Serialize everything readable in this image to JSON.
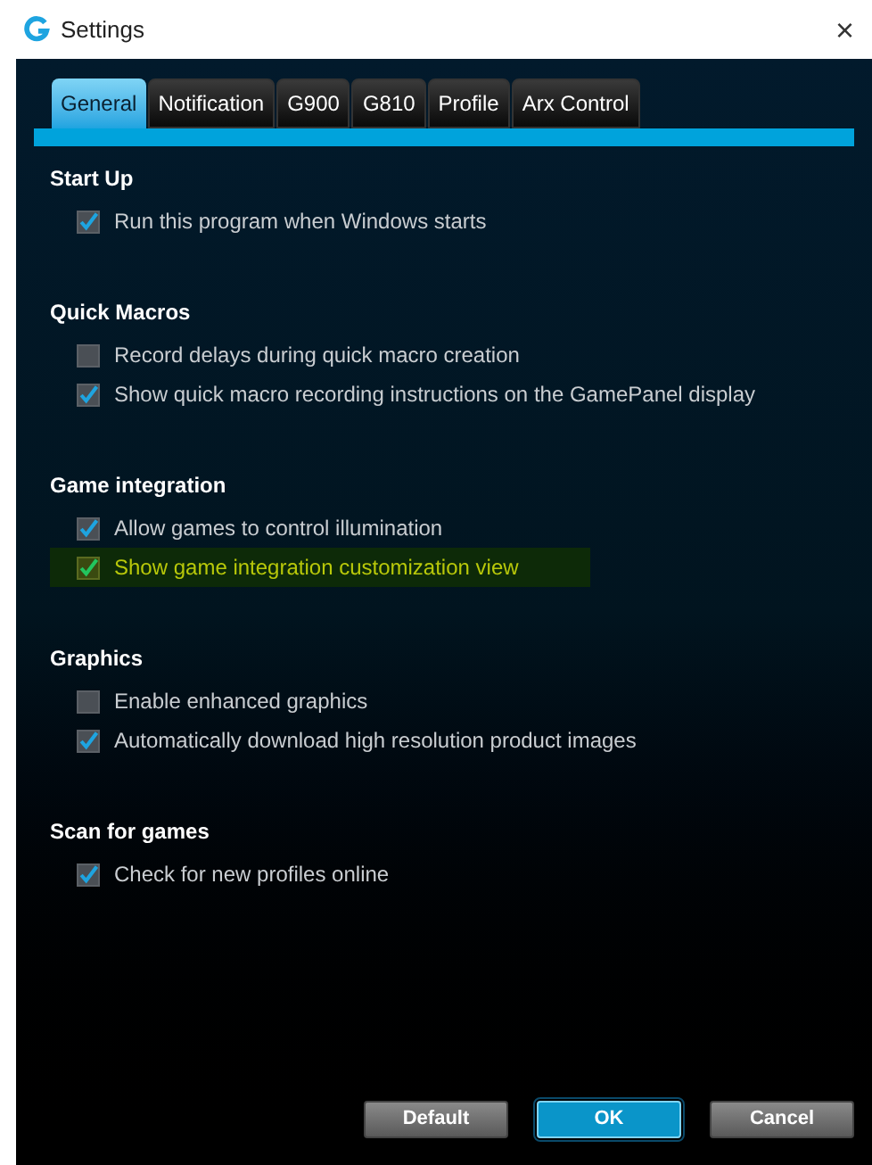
{
  "window": {
    "title": "Settings",
    "close": "×"
  },
  "tabs": [
    {
      "label": "General",
      "selected": true
    },
    {
      "label": "Notification",
      "selected": false
    },
    {
      "label": "G900",
      "selected": false
    },
    {
      "label": "G810",
      "selected": false
    },
    {
      "label": "Profile",
      "selected": false
    },
    {
      "label": "Arx Control",
      "selected": false
    }
  ],
  "sections": [
    {
      "title": "Start Up",
      "options": [
        {
          "label": "Run this program when Windows starts",
          "checked": true,
          "highlighted": false
        }
      ]
    },
    {
      "title": "Quick Macros",
      "options": [
        {
          "label": "Record delays during quick macro creation",
          "checked": false,
          "highlighted": false
        },
        {
          "label": "Show quick macro recording instructions on the GamePanel display",
          "checked": true,
          "highlighted": false
        }
      ]
    },
    {
      "title": "Game integration",
      "options": [
        {
          "label": "Allow games to control illumination",
          "checked": true,
          "highlighted": false
        },
        {
          "label": "Show game integration customization view",
          "checked": true,
          "highlighted": true
        }
      ]
    },
    {
      "title": "Graphics",
      "options": [
        {
          "label": "Enable enhanced graphics",
          "checked": false,
          "highlighted": false
        },
        {
          "label": "Automatically download high resolution product images",
          "checked": true,
          "highlighted": false
        }
      ]
    },
    {
      "title": "Scan for games",
      "options": [
        {
          "label": "Check for new profiles online",
          "checked": true,
          "highlighted": false
        }
      ]
    }
  ],
  "buttons": [
    {
      "label": "Default",
      "kind": "secondary"
    },
    {
      "label": "OK",
      "kind": "primary"
    },
    {
      "label": "Cancel",
      "kind": "secondary"
    }
  ]
}
